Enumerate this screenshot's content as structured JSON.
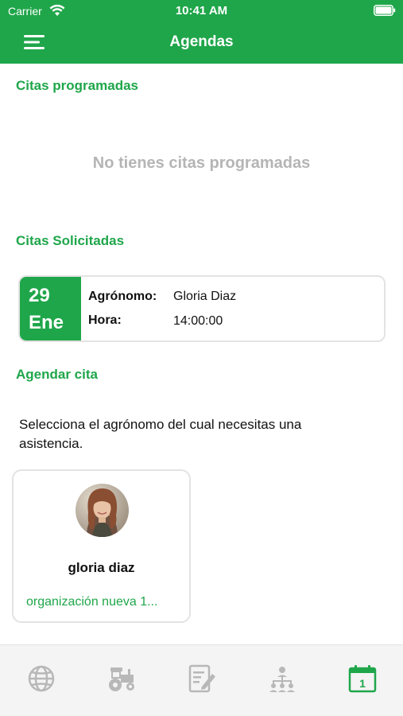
{
  "status_bar": {
    "carrier": "Carrier",
    "time": "10:41 AM"
  },
  "nav": {
    "title": "Agendas",
    "menu_icon": "hamburger-menu-icon"
  },
  "scheduled": {
    "title": "Citas programadas",
    "empty_message": "No tienes citas programadas"
  },
  "requested": {
    "title": "Citas Solicitadas",
    "appointment": {
      "day": "29",
      "month": "Ene",
      "agronomist_label": "Agrónomo:",
      "agronomist_value": "Gloria Diaz",
      "time_label": "Hora:",
      "time_value": "14:00:00"
    }
  },
  "schedule": {
    "title": "Agendar cita",
    "instructions": "Selecciona el agrónomo del cual necesitas una asistencia.",
    "agronomists": [
      {
        "name": "gloria diaz",
        "organization": "organización nueva 1..."
      }
    ]
  },
  "tabbar": {
    "tabs": [
      {
        "icon": "globe-icon",
        "active": false
      },
      {
        "icon": "tractor-icon",
        "active": false
      },
      {
        "icon": "edit-document-icon",
        "active": false
      },
      {
        "icon": "network-icon",
        "active": false
      },
      {
        "icon": "calendar-icon",
        "active": true,
        "badge": "1"
      }
    ]
  },
  "colors": {
    "brand_green": "#1fa64a",
    "inactive_icon": "#b8b8b8",
    "muted_text": "#b5b5b5"
  }
}
